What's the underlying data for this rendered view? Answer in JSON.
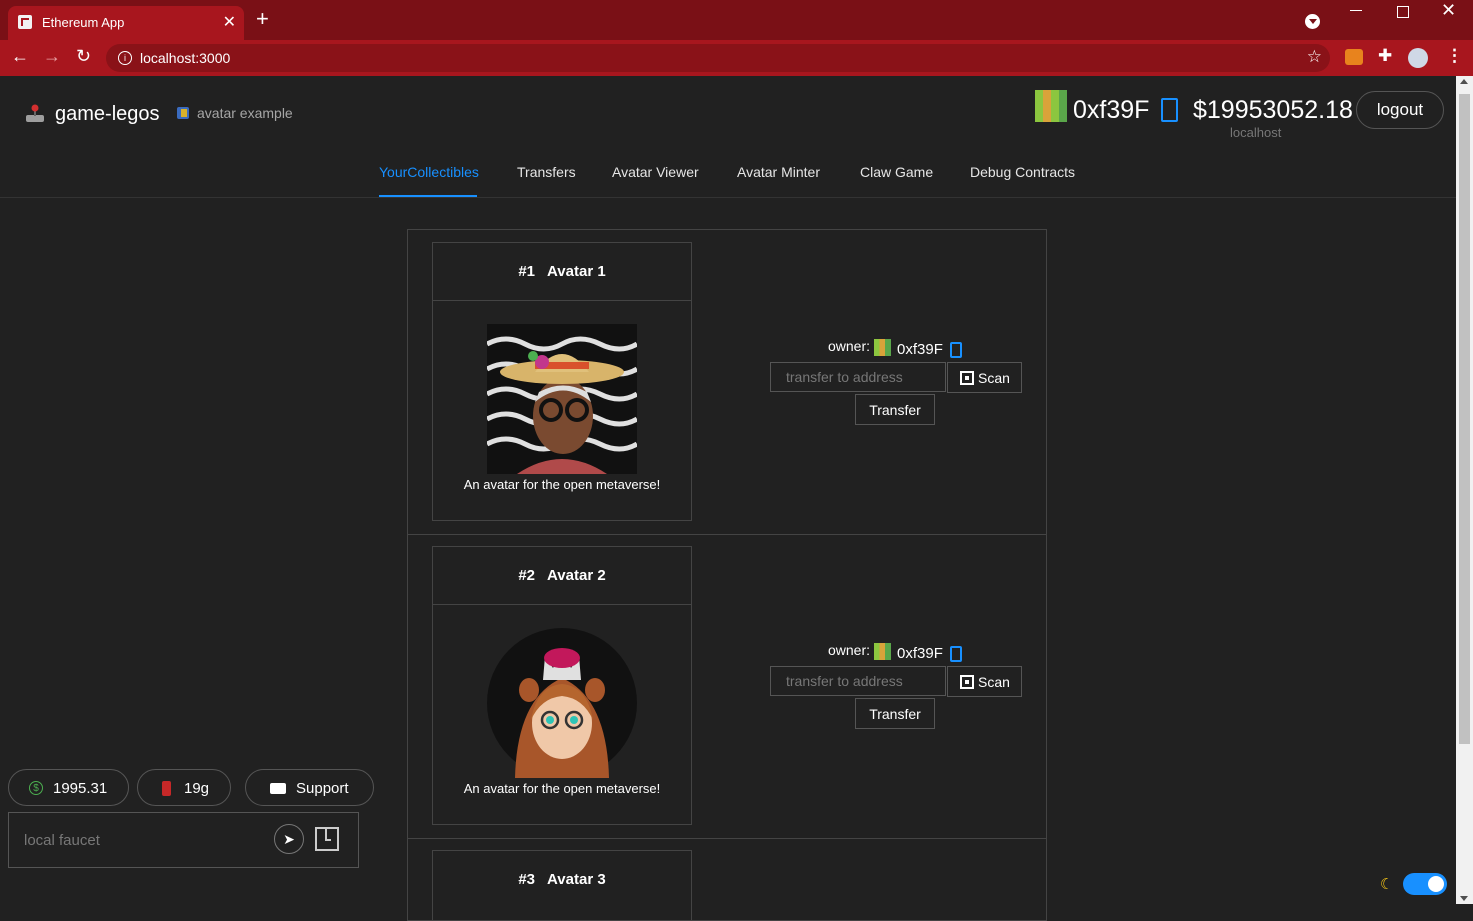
{
  "browser": {
    "tab_title": "Ethereum App",
    "tab_close": "✕",
    "new_tab": "+",
    "url": "localhost:3000",
    "nav_back": "←",
    "nav_forward": "→",
    "nav_reload": "↻",
    "info": "i",
    "star": "☆",
    "puzzle": "✚",
    "menu": "⋮",
    "win_close": "✕"
  },
  "header": {
    "title": "game-legos",
    "subtitle": "avatar example",
    "account_address": "0xf39F",
    "balance": "$19953052.18",
    "network": "localhost",
    "logout_label": "logout"
  },
  "menu": {
    "items": [
      {
        "label": "YourCollectibles",
        "active": true
      },
      {
        "label": "Transfers"
      },
      {
        "label": "Avatar Viewer"
      },
      {
        "label": "Avatar Minter"
      },
      {
        "label": "Claw Game"
      },
      {
        "label": "Debug Contracts"
      }
    ]
  },
  "collectibles": [
    {
      "number": "#1",
      "name": "Avatar 1",
      "description": "An avatar for the open metaverse!",
      "owner_label": "owner:",
      "owner": "0xf39F",
      "transfer_placeholder": "transfer to address",
      "scan_label": "Scan",
      "transfer_label": "Transfer"
    },
    {
      "number": "#2",
      "name": "Avatar 2",
      "description": "An avatar for the open metaverse!",
      "owner_label": "owner:",
      "owner": "0xf39F",
      "transfer_placeholder": "transfer to address",
      "scan_label": "Scan",
      "transfer_label": "Transfer"
    },
    {
      "number": "#3",
      "name": "Avatar 3"
    }
  ],
  "footer": {
    "eth_price": "1995.31",
    "gas_price": "19g",
    "support_label": "Support",
    "faucet_placeholder": "local faucet",
    "send_icon": "➤",
    "dollar_icon": "$",
    "moon_icon": "☾"
  },
  "colors": {
    "accent": "#1890ff",
    "chrome_dark": "#7a1016",
    "chrome": "#a8161e",
    "background": "#212121"
  }
}
